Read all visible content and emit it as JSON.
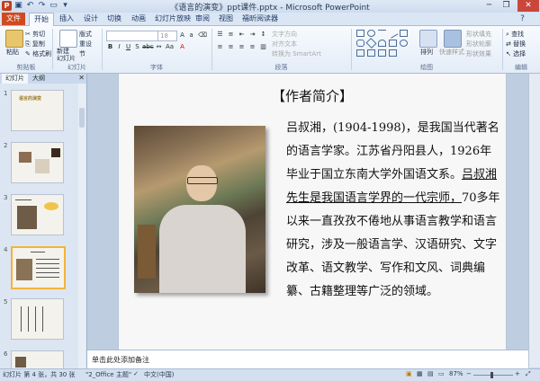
{
  "window": {
    "title": "《语言的演变》ppt课件.pptx - Microsoft PowerPoint",
    "controls": {
      "minimize": "─",
      "maximize": "❐",
      "close": "✕"
    }
  },
  "tabs": [
    "文件",
    "开始",
    "插入",
    "设计",
    "切换",
    "动画",
    "幻灯片放映",
    "审阅",
    "视图",
    "福昕阅读器"
  ],
  "ribbon": {
    "clipboard": {
      "paste": "粘贴",
      "cut": "剪切",
      "copy": "复制",
      "format_painter": "格式刷",
      "label": "剪贴板"
    },
    "slides": {
      "new_slide": "新建\n幻灯片",
      "layout": "版式",
      "reset": "重设",
      "section": "节",
      "label": "幻灯片"
    },
    "font": {
      "size": "18",
      "label": "字体"
    },
    "paragraph": {
      "text_direction": "文字方向",
      "align_text": "对齐文本",
      "smartart": "转换为 SmartArt",
      "label": "段落"
    },
    "drawing": {
      "arrange": "排列",
      "quick_styles": "快速样式",
      "shape_fill": "形状填充",
      "shape_outline": "形状轮廓",
      "shape_effects": "形状效果",
      "label": "绘图"
    },
    "editing": {
      "find": "查找",
      "replace": "替换",
      "select": "选择",
      "label": "编辑"
    }
  },
  "left_panel": {
    "tabs": [
      "幻灯片",
      "大纲"
    ],
    "slide_numbers": [
      "1",
      "2",
      "3",
      "4",
      "5",
      "6"
    ],
    "selected": 4
  },
  "slide": {
    "heading": "【作者简介】",
    "text_before": "吕叔湘，(1904-1998)，是我国当代著名的语言学家。江苏省丹阳县人，1926年毕业于国立东南大学外国语文系。",
    "text_underlined": "吕叔湘先生是我国语言学界的一代宗师，",
    "text_after": "70多年以来一直孜孜不倦地从事语言教学和语言研究，涉及一般语言学、汉语研究、文字改革、语文教学、写作和文风、词典编纂、古籍整理等广泛的领域。"
  },
  "notes": {
    "placeholder": "单击此处添加备注"
  },
  "status": {
    "slide_info": "幻灯片 第 4 张，共 30 张",
    "theme": "\"2_Office 主题\"",
    "language": "中文(中国)",
    "zoom": "87%"
  }
}
